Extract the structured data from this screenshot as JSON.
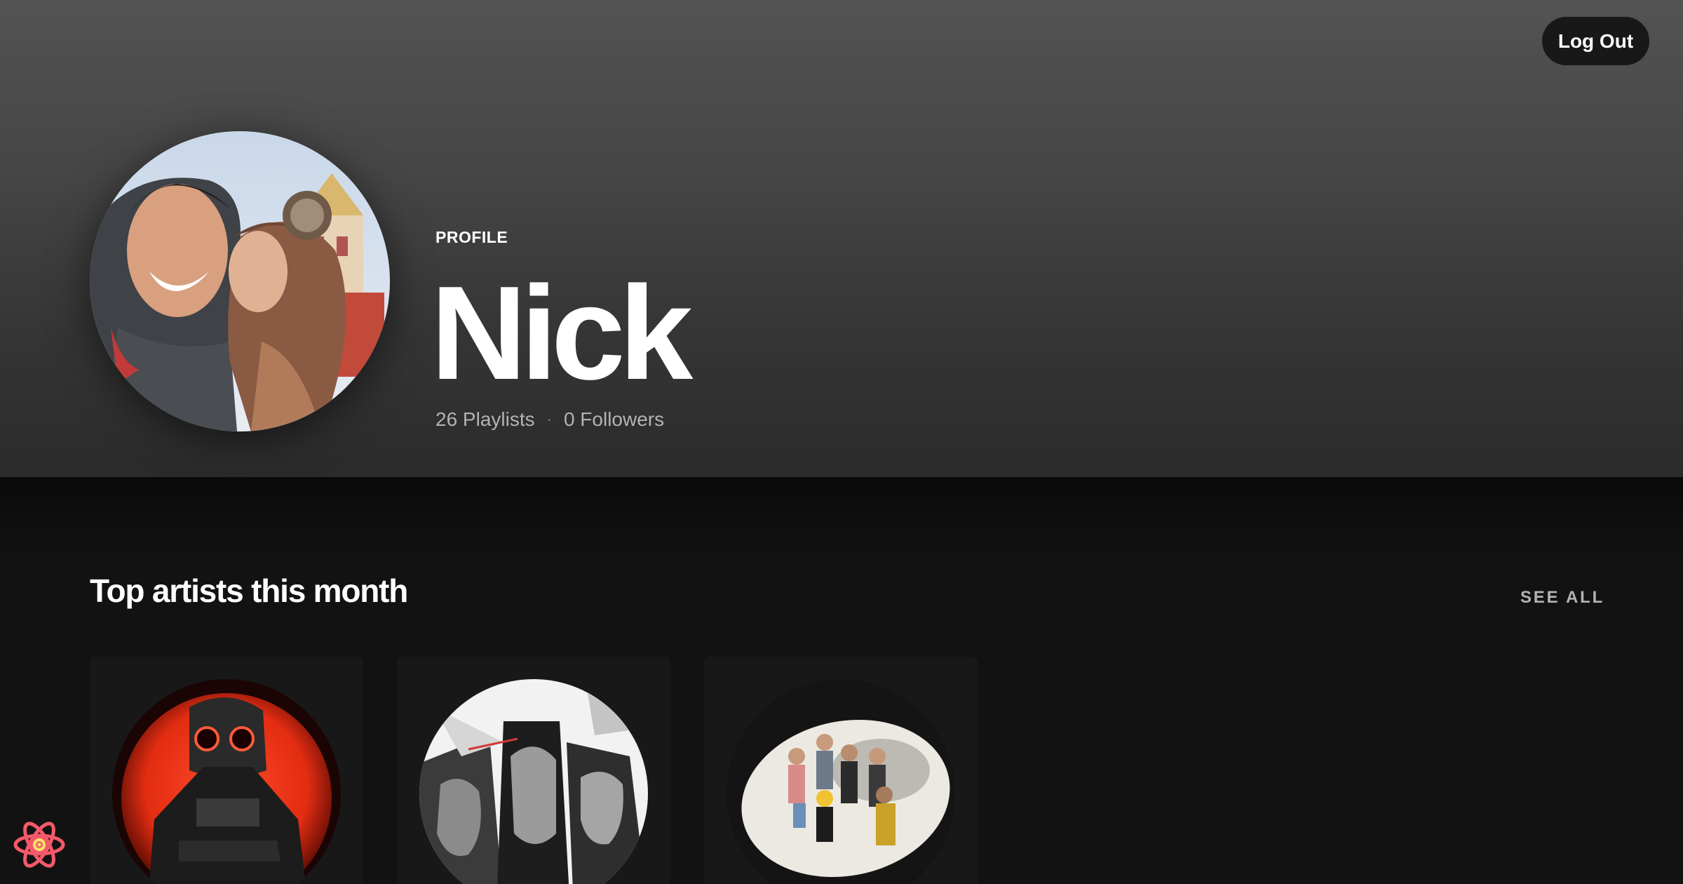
{
  "header": {
    "logout_label": "Log Out",
    "profile_label": "PROFILE",
    "name": "Nick",
    "playlists": "26 Playlists",
    "separator": "·",
    "followers": "0 Followers"
  },
  "top_artists": {
    "title": "Top artists this month",
    "see_all_label": "SEE ALL",
    "artists": [
      {
        "image": "artist-red-glowing-goggles"
      },
      {
        "image": "artist-bw-collage"
      },
      {
        "image": "artist-band-group-photo"
      }
    ]
  },
  "icons": {
    "devtools": "react-devtools-icon"
  },
  "colors": {
    "background": "#121212",
    "card": "#181818",
    "header_top": "#535353",
    "header_bottom": "#2b2b2b",
    "muted_text": "#b3b3b3",
    "accent_red": "#e8331c"
  }
}
